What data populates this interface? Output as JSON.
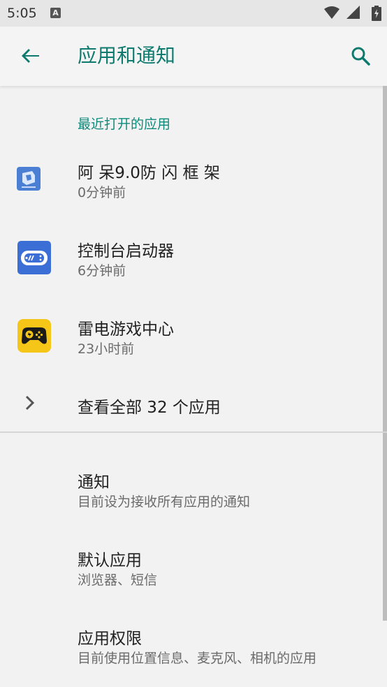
{
  "status_bar": {
    "time": "5:05",
    "notification_icon": "A",
    "icons": [
      "wifi-icon",
      "signal-icon",
      "battery-charging-icon"
    ]
  },
  "app_bar": {
    "title": "应用和通知",
    "back_icon": "arrow-back-icon",
    "search_icon": "search-icon"
  },
  "recent_apps": {
    "header": "最近打开的应用",
    "items": [
      {
        "name": "阿 呆9.0防 闪 框 架",
        "time": "0分钟前",
        "icon": "adai-app-icon"
      },
      {
        "name": "控制台启动器",
        "time": "6分钟前",
        "icon": "console-launcher-icon"
      },
      {
        "name": "雷电游戏中心",
        "time": "23小时前",
        "icon": "leidian-game-center-icon"
      }
    ],
    "see_all": "查看全部 32 个应用"
  },
  "settings": [
    {
      "title": "通知",
      "summary": "目前设为接收所有应用的通知"
    },
    {
      "title": "默认应用",
      "summary": "浏览器、短信"
    },
    {
      "title": "应用权限",
      "summary": "目前使用位置信息、麦克风、相机的应用"
    }
  ],
  "colors": {
    "accent": "#0e7a6e",
    "background": "#f2f2f2",
    "console_icon": "#3b6fd6",
    "leidian_icon": "#f5c518"
  }
}
